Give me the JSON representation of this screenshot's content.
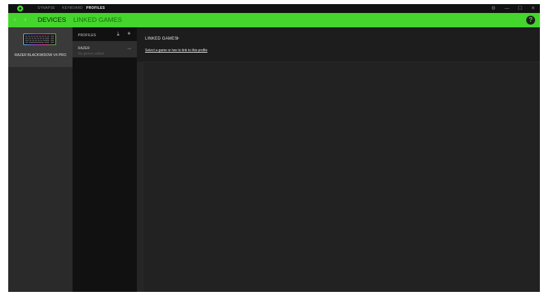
{
  "titlebar": {
    "tabs": [
      {
        "label": "SYNAPSE",
        "active": false
      },
      {
        "label": "KEYBOARD",
        "active": false
      },
      {
        "label": "PROFILES",
        "active": true
      }
    ],
    "controls": {
      "settings": "⚙",
      "minimize": "—",
      "maximize": "☐",
      "close": "✕"
    }
  },
  "navbar": {
    "back": "‹",
    "forward": "›",
    "items": [
      {
        "label": "DEVICES",
        "active": true
      },
      {
        "label": "LINKED GAMES",
        "active": false
      }
    ],
    "help": "?"
  },
  "device": {
    "name": "RAZER BLACKWIDOW V4 PRO"
  },
  "profiles": {
    "label": "PROFILES",
    "import_icon": "⤓",
    "add_icon": "+",
    "items": [
      {
        "name": "RAZER",
        "sub": "No games added",
        "more": "···"
      }
    ]
  },
  "linked_games": {
    "title": "LINKED GAMES",
    "add_icon": "+",
    "link_text": "Select a game or two to link to this profile"
  },
  "colors": {
    "accent": "#44d62c",
    "background": "#1d1d1d",
    "panel": "#2a2a2a"
  }
}
